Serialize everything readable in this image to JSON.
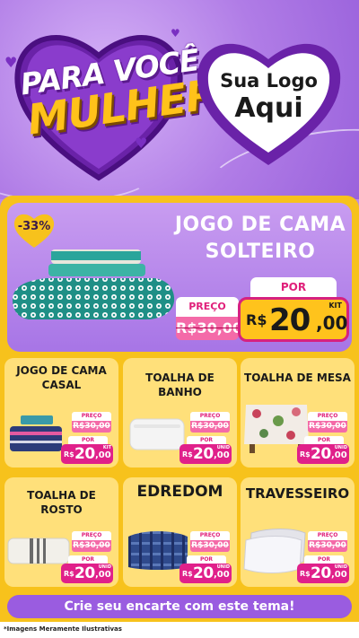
{
  "header": {
    "headline_line1": "PARA VOCÊ,",
    "headline_line2": "MULHER",
    "logo_line1": "Sua Logo",
    "logo_line2": "Aqui"
  },
  "hero": {
    "discount": "-33%",
    "title_line1": "JOGO DE CAMA",
    "title_line2": "SOLTEIRO",
    "old_label": "PREÇO",
    "old_price": "R$30,00",
    "new_label": "POR",
    "currency": "R$",
    "new_price_int": "20",
    "new_price_cents": ",00",
    "unit": "KIT"
  },
  "products": [
    {
      "title": "JOGO DE CAMA CASAL",
      "old_label": "PREÇO",
      "old_price": "R$30,00",
      "new_label": "POR",
      "currency": "R$",
      "int": "20",
      "cents": ",00",
      "unit": "KIT"
    },
    {
      "title": "TOALHA DE BANHO",
      "old_label": "PREÇO",
      "old_price": "R$30,00",
      "new_label": "POR",
      "currency": "R$",
      "int": "20",
      "cents": ",00",
      "unit": "UNID"
    },
    {
      "title": "TOALHA DE MESA",
      "old_label": "PREÇO",
      "old_price": "R$30,00",
      "new_label": "POR",
      "currency": "R$",
      "int": "20",
      "cents": ",00",
      "unit": "UNID"
    },
    {
      "title": "TOALHA DE ROSTO",
      "old_label": "PREÇO",
      "old_price": "R$30,00",
      "new_label": "POR",
      "currency": "R$",
      "int": "20",
      "cents": ",00",
      "unit": "UNID"
    },
    {
      "title": "EDREDOM",
      "old_label": "PREÇO",
      "old_price": "R$30,00",
      "new_label": "POR",
      "currency": "R$",
      "int": "20",
      "cents": ",00",
      "unit": "UNID"
    },
    {
      "title": "TRAVESSEIRO",
      "old_label": "PREÇO",
      "old_price": "R$30,00",
      "new_label": "POR",
      "currency": "R$",
      "int": "20",
      "cents": ",00",
      "unit": "UNID"
    }
  ],
  "cta": "Crie seu encarte com este tema!",
  "footer_note": "*Imagens Meramente Ilustrativas",
  "colors": {
    "purple": "#a775e6",
    "yellow": "#f7c21c",
    "pink": "#e0208a",
    "dark_purple": "#5b1a8e"
  }
}
